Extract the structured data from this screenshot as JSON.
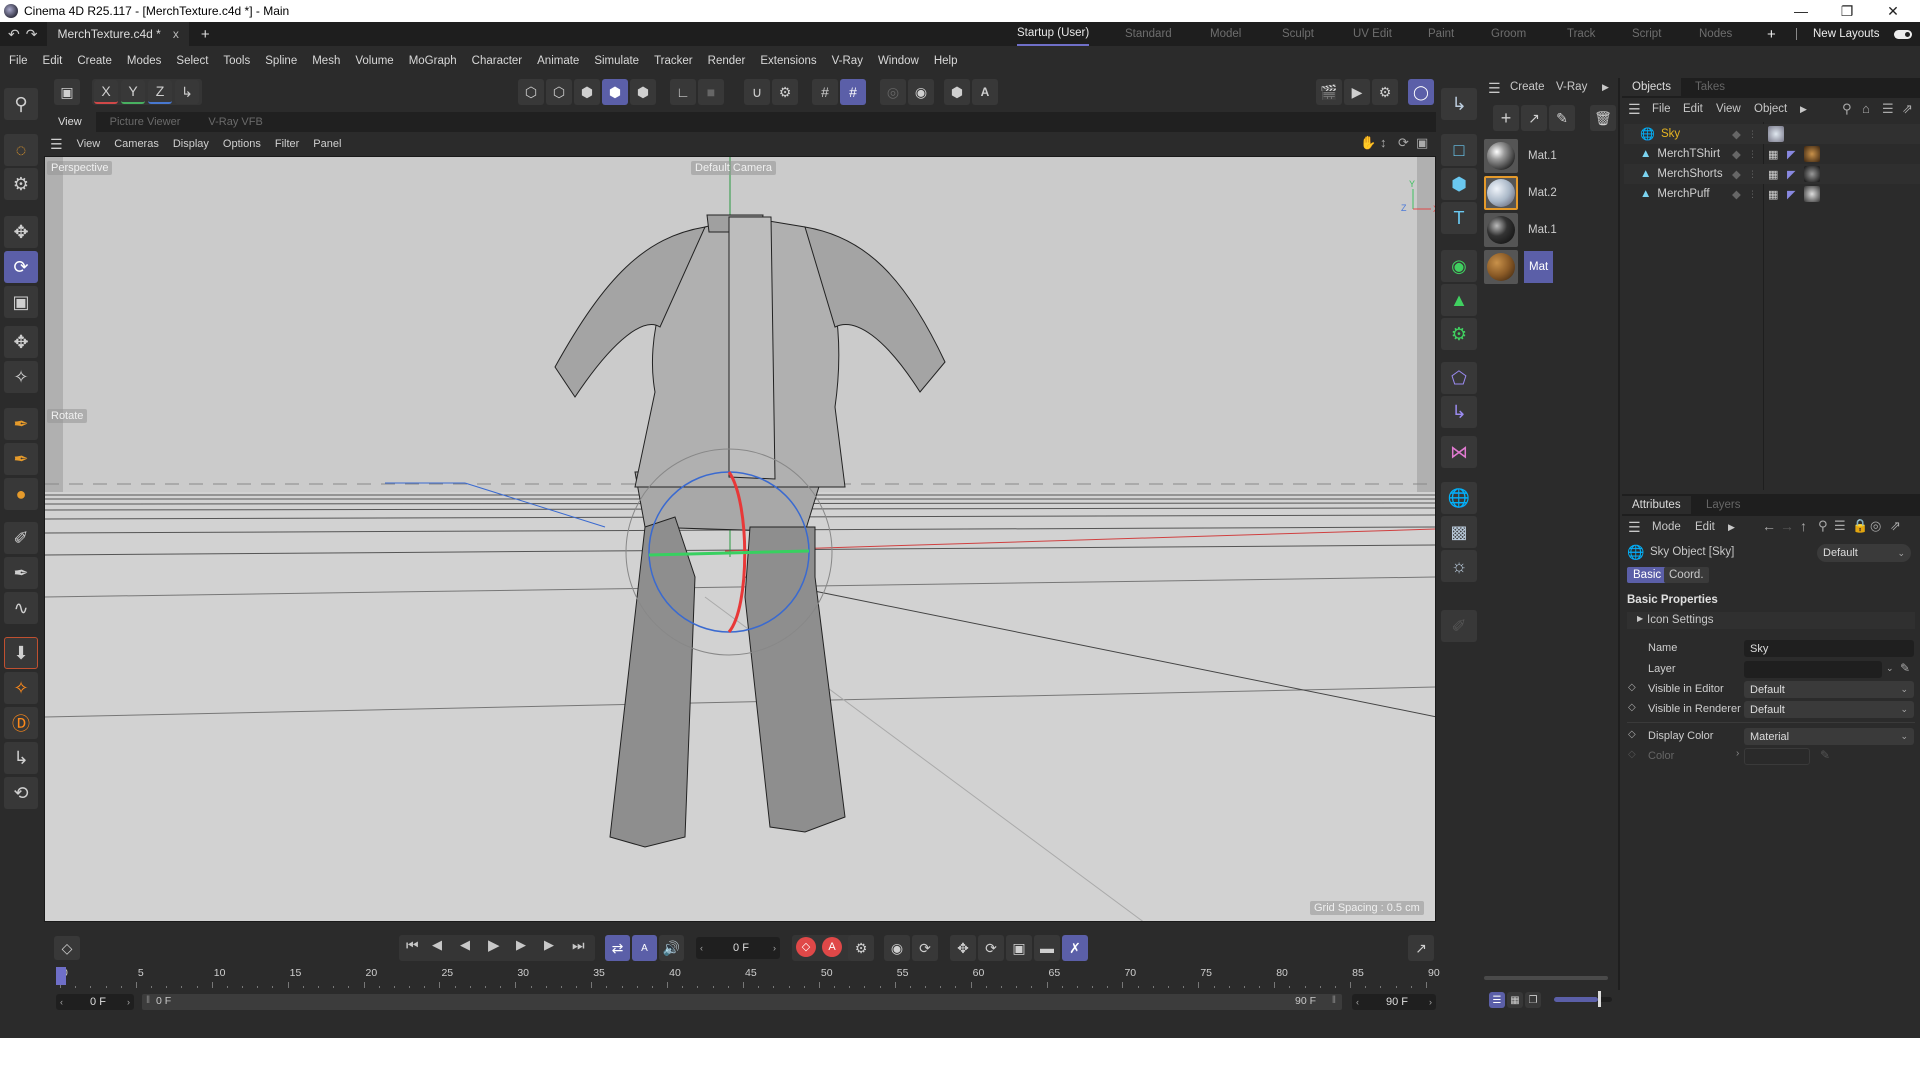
{
  "window": {
    "title": "Cinema 4D R25.117 - [MerchTexture.c4d *] - Main",
    "controls": [
      "minimize",
      "restore",
      "close"
    ]
  },
  "tabbar": {
    "document_tab": "MerchTexture.c4d *",
    "close_glyph": "x",
    "add_glyph": "+",
    "layouts": [
      "Startup (User)",
      "Standard",
      "Model",
      "Sculpt",
      "UV Edit",
      "Paint",
      "Groom",
      "Track",
      "Script",
      "Nodes"
    ],
    "active_layout": "Startup (User)",
    "new_layouts_label": "New Layouts",
    "new_layouts_toggle": true
  },
  "menubar": [
    "File",
    "Edit",
    "Create",
    "Modes",
    "Select",
    "Tools",
    "Spline",
    "Mesh",
    "Volume",
    "MoGraph",
    "Character",
    "Animate",
    "Simulate",
    "Tracker",
    "Render",
    "Extensions",
    "V-Ray",
    "Window",
    "Help"
  ],
  "toolbar": {
    "axis_x": "X",
    "axis_y": "Y",
    "axis_z": "Z",
    "icons": [
      "undo-icon",
      "redo-icon",
      "object-mode-icon",
      "point-mode-icon",
      "edge-mode-icon",
      "polygon-mode-icon",
      "uv-mode-icon",
      "axis-mode-icon",
      "tweak-mode-icon",
      "snap-icon",
      "snap-settings-icon",
      "grid-icon",
      "locked-workplane-icon",
      "viewport-solo-icon",
      "solo-settings-icon",
      "display-icon",
      "annotation-icon",
      "render-view-icon",
      "render-picture-viewer-icon",
      "render-settings-icon",
      "vray-icon"
    ]
  },
  "view": {
    "tabs": [
      "View",
      "Picture Viewer",
      "V-Ray VFB"
    ],
    "active_tab": "View",
    "menu": [
      "View",
      "Cameras",
      "Display",
      "Options",
      "Filter",
      "Panel"
    ],
    "camera_label": "Perspective",
    "default_camera": "Default Camera",
    "tool_label": "Rotate",
    "grid_spacing": "Grid Spacing : 0.5 cm",
    "axis_labels": {
      "x": "X",
      "y": "Y",
      "z": "Z"
    }
  },
  "materials": {
    "menu": [
      "Create",
      "V-Ray"
    ],
    "items": [
      {
        "name": "Mat.1",
        "color": "#8a8a8a",
        "selected": false
      },
      {
        "name": "Mat.2",
        "color": "#a9b7c4",
        "selected": false,
        "highlight": "#e59a2b"
      },
      {
        "name": "Mat.1",
        "color": "#3a3a3a",
        "selected": false
      },
      {
        "name": "Mat",
        "color": "#8a5a26",
        "selected": true
      }
    ]
  },
  "objects": {
    "tabs": [
      "Objects",
      "Takes"
    ],
    "active_tab": "Objects",
    "menu": [
      "File",
      "Edit",
      "View",
      "Object"
    ],
    "rows": [
      {
        "name": "Sky",
        "icon": "sky-icon",
        "active": true
      },
      {
        "name": "MerchTShirt",
        "icon": "polygon-object-icon",
        "active": false
      },
      {
        "name": "MerchShorts",
        "icon": "polygon-object-icon",
        "active": false
      },
      {
        "name": "MerchPuff",
        "icon": "polygon-object-icon",
        "active": false
      }
    ]
  },
  "attributes": {
    "tabs": [
      "Attributes",
      "Layers"
    ],
    "active_tab": "Attributes",
    "menu": [
      "Mode",
      "Edit"
    ],
    "object_title": "Sky Object [Sky]",
    "preset": "Default",
    "subtabs": [
      "Basic",
      "Coord."
    ],
    "active_subtab": "Basic",
    "section": "Basic Properties",
    "group": "Icon Settings",
    "fields": {
      "name_label": "Name",
      "name_value": "Sky",
      "layer_label": "Layer",
      "layer_value": "",
      "vis_editor_label": "Visible in Editor",
      "vis_editor_value": "Default",
      "vis_renderer_label": "Visible in Renderer",
      "vis_renderer_value": "Default",
      "display_color_label": "Display Color",
      "display_color_value": "Material",
      "color_label": "Color"
    }
  },
  "timeline": {
    "current_frame": "0 F",
    "start_frame": "0 F",
    "range_start": "0 F",
    "range_end": "90 F",
    "end_frame": "90 F",
    "ticks": [
      "0",
      "5",
      "10",
      "15",
      "20",
      "25",
      "30",
      "35",
      "40",
      "45",
      "50",
      "55",
      "60",
      "65",
      "70",
      "75",
      "80",
      "85",
      "90"
    ],
    "max_frame": 90,
    "playhead_frame": 0
  },
  "material_zoom_slider": 0.75,
  "colors": {
    "accent": "#5b5fa8",
    "active_object": "#e6b422",
    "axis_x": "#e04848",
    "axis_y": "#3fc060",
    "axis_z": "#4a78d8"
  }
}
